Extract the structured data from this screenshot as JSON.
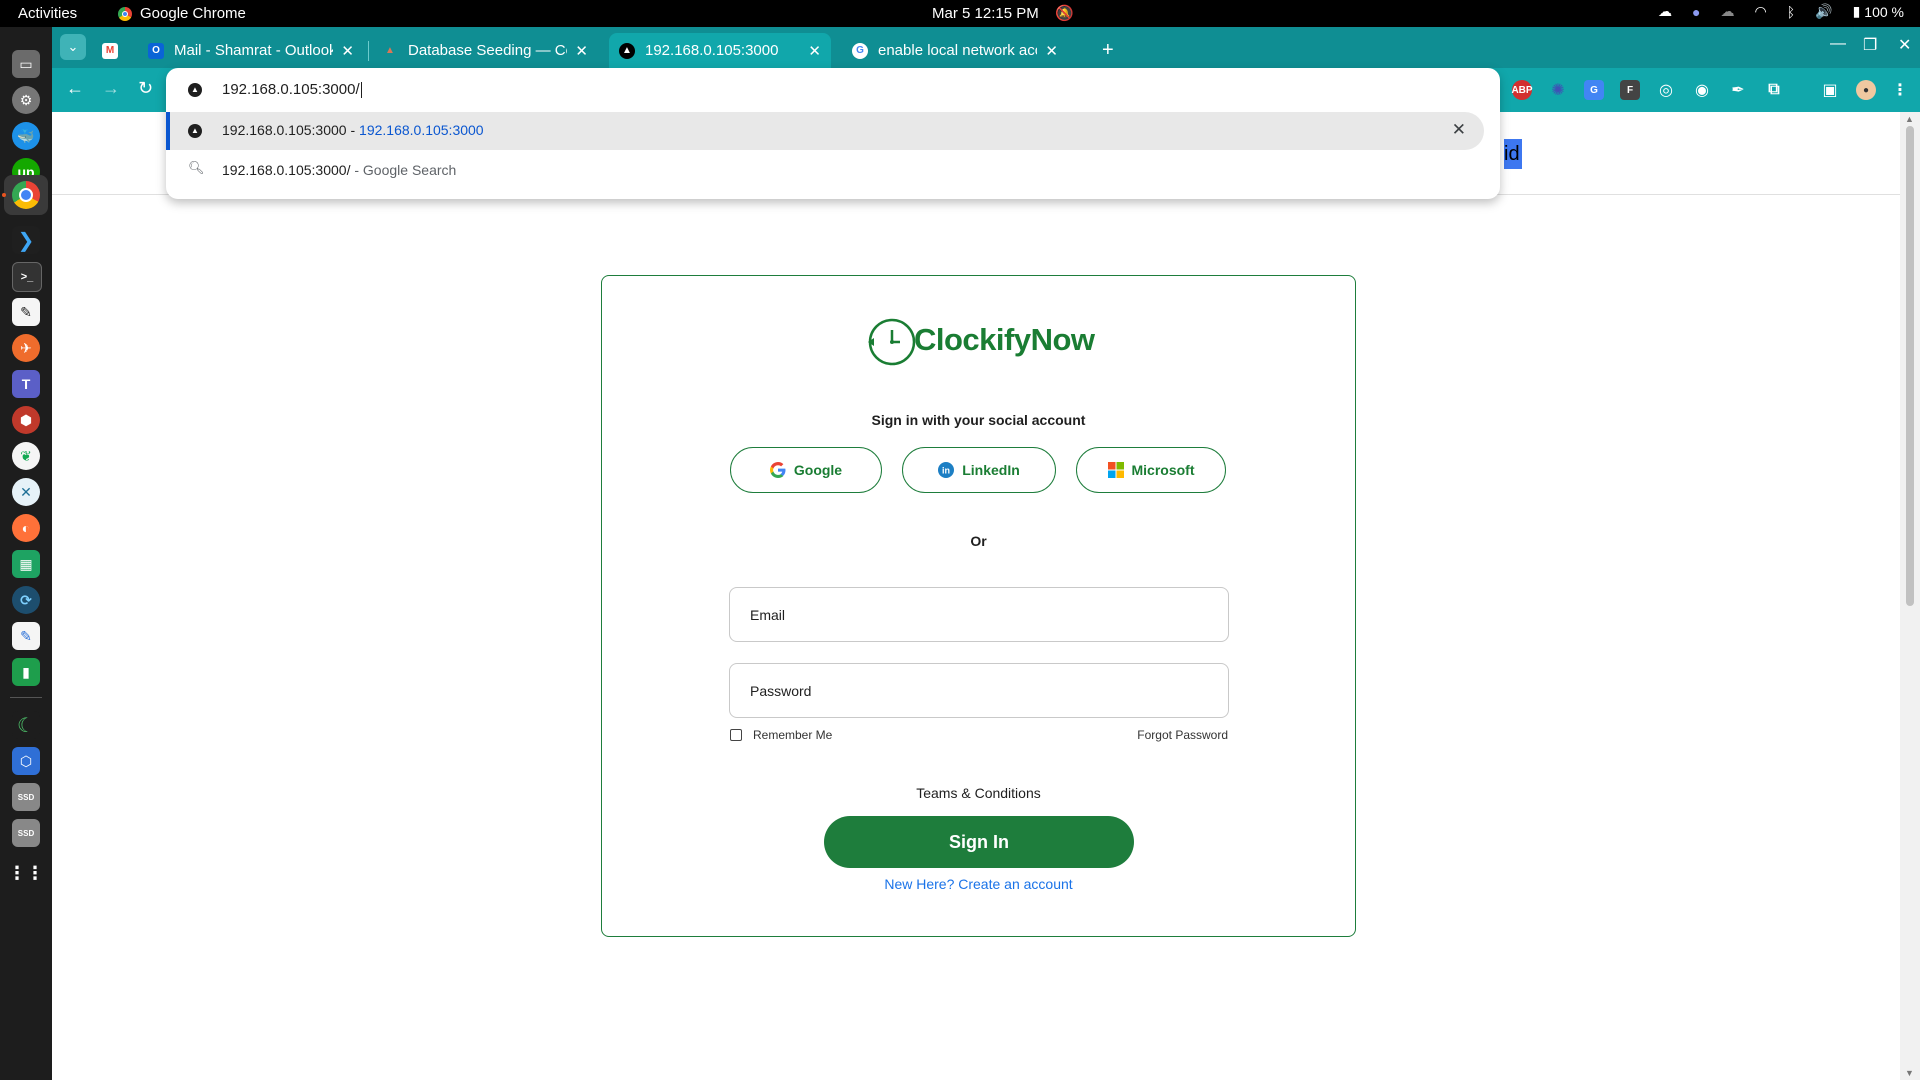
{
  "system": {
    "activities": "Activities",
    "app_name": "Google Chrome",
    "clock": "Mar 5  12:15 PM",
    "battery": "100 %"
  },
  "browser": {
    "tabs": [
      {
        "title": "Mail - Shamrat - Outlook",
        "active": false
      },
      {
        "title": "Database Seeding — Co",
        "active": false
      },
      {
        "title": "192.168.0.105:3000",
        "active": true
      },
      {
        "title": "enable local network acc",
        "active": false
      }
    ],
    "omnibox": {
      "input_value": "192.168.0.105:3000/",
      "suggestions": [
        {
          "title": "192.168.0.105:3000",
          "separator": " - ",
          "url": "192.168.0.105:3000",
          "selected": true
        },
        {
          "title": "192.168.0.105:3000/",
          "separator": " - ",
          "desc": "Google Search",
          "selected": false
        }
      ]
    },
    "extensions": [
      "ABP",
      "F"
    ]
  },
  "page": {
    "header_fragment": "id",
    "brand": "ClockifyNow",
    "social_title": "Sign in with your social account",
    "social_buttons": {
      "google": "Google",
      "linkedin": "LinkedIn",
      "microsoft": "Microsoft"
    },
    "or_text": "Or",
    "email_placeholder": "Email",
    "password_placeholder": "Password",
    "remember_label": "Remember Me",
    "forgot_label": "Forgot Password",
    "terms": "Teams & Conditions",
    "signin_label": "Sign In",
    "create_account": "New Here? Create an account"
  },
  "colors": {
    "brand_green": "#1e7d3c",
    "link_blue": "#1a73e8",
    "chrome_teal": "#11a7ab"
  }
}
